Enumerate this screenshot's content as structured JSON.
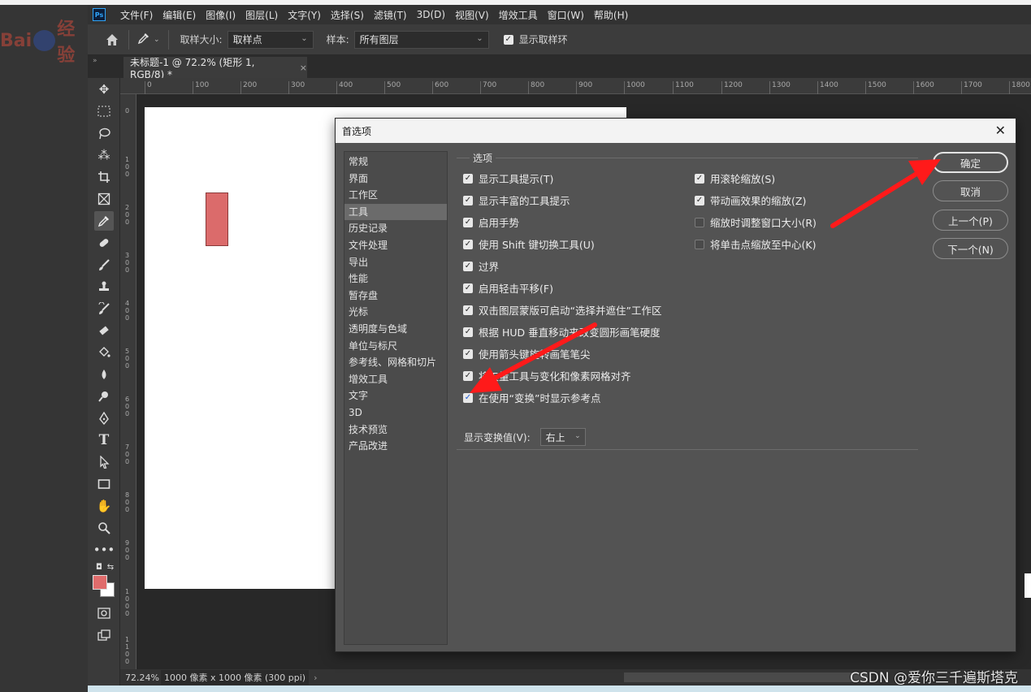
{
  "menubar": {
    "logo": "Ps",
    "items": [
      "文件(F)",
      "编辑(E)",
      "图像(I)",
      "图层(L)",
      "文字(Y)",
      "选择(S)",
      "滤镜(T)",
      "3D(D)",
      "视图(V)",
      "增效工具",
      "窗口(W)",
      "帮助(H)"
    ]
  },
  "options": {
    "sample_size_label": "取样大小:",
    "sample_size_value": "取样点",
    "sample_label": "样本:",
    "sample_value": "所有图层",
    "show_ring_label": "显示取样环"
  },
  "document_tab": {
    "title": "未标题-1 @ 72.2% (矩形 1, RGB/8) *",
    "close": "×"
  },
  "ruler": {
    "h_ticks": [
      "0",
      "100",
      "200",
      "300",
      "400",
      "500",
      "600",
      "700",
      "800",
      "900",
      "1000",
      "1100",
      "1200",
      "1300",
      "1400",
      "1500",
      "1600",
      "1700",
      "1800"
    ],
    "v_ticks": [
      "0",
      "100",
      "200",
      "300",
      "400",
      "500",
      "600",
      "700",
      "800",
      "900",
      "1000",
      "1100"
    ]
  },
  "status": {
    "zoom": "72.24%",
    "doc_info": "1000 像素 x 1000 像素 (300 ppi)",
    "chevron": "›"
  },
  "dialog": {
    "title": "首选项",
    "nav": [
      "常规",
      "界面",
      "工作区",
      "工具",
      "历史记录",
      "文件处理",
      "导出",
      "性能",
      "暂存盘",
      "光标",
      "透明度与色域",
      "单位与标尺",
      "参考线、网格和切片",
      "增效工具",
      "文字",
      "3D",
      "技术预览",
      "产品改进"
    ],
    "selected_nav": "工具",
    "group_title": "选项",
    "left_options": [
      {
        "label": "显示工具提示(T)",
        "checked": true
      },
      {
        "label": "显示丰富的工具提示",
        "checked": true
      },
      {
        "label": "启用手势",
        "checked": true
      },
      {
        "label": "使用 Shift 键切换工具(U)",
        "checked": true
      },
      {
        "label": "过界",
        "checked": true
      },
      {
        "label": "启用轻击平移(F)",
        "checked": true
      },
      {
        "label": "双击图层蒙版可启动“选择并遮住”工作区",
        "checked": true
      },
      {
        "label": "根据 HUD 垂直移动来改变圆形画笔硬度",
        "checked": true
      },
      {
        "label": "使用箭头键旋转画笔笔尖",
        "checked": true
      },
      {
        "label": "将矢量工具与变化和像素网格对齐",
        "checked": true
      },
      {
        "label": "在使用“变换”时显示参考点",
        "checked": true
      }
    ],
    "right_options": [
      {
        "label": "用滚轮缩放(S)",
        "checked": true
      },
      {
        "label": "带动画效果的缩放(Z)",
        "checked": true
      },
      {
        "label": "缩放时调整窗口大小(R)",
        "checked": false
      },
      {
        "label": "将单击点缩放至中心(K)",
        "checked": false
      }
    ],
    "transform_label": "显示变换值(V):",
    "transform_value": "右上",
    "buttons": {
      "ok": "确定",
      "cancel": "取消",
      "prev": "上一个(P)",
      "next": "下一个(N)"
    },
    "close": "✕"
  },
  "watermark": "CSDN @爱你三千遍斯塔克",
  "baidu": {
    "text_left": "Bai",
    "text_mid": "du",
    "text_right": "经验"
  },
  "colors": {
    "foreground": "#e06c6c",
    "background": "#ffffff",
    "arrow": "#ff1a1a"
  }
}
